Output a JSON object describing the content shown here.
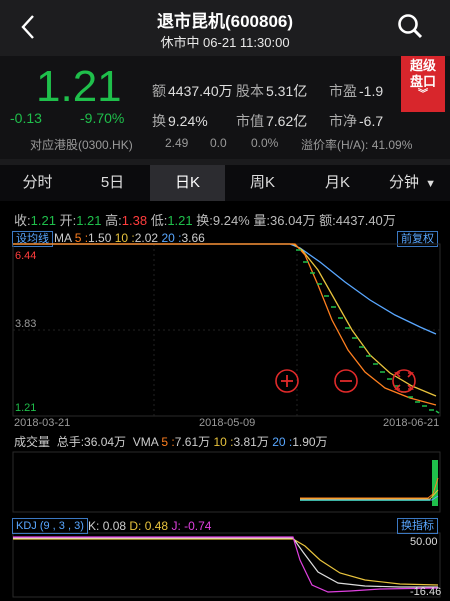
{
  "header": {
    "title": "退市昆机(600806)",
    "subtitle": "休市中 06-21 11:30:00"
  },
  "quote": {
    "price": "1.21",
    "change": "-0.13",
    "change_pct": "-9.70%",
    "amount_label": "额",
    "amount": "4437.40万",
    "share_cap_label": "股本",
    "share_cap": "5.31亿",
    "pe_label": "市盈",
    "pe": "-1.9",
    "turnover_label": "换",
    "turnover": "9.24%",
    "mkt_cap_label": "市值",
    "mkt_cap": "7.62亿",
    "pb_label": "市净",
    "pb": "-6.7",
    "hk_name": "对应港股(0300.HK)",
    "hk_price": "2.49",
    "hk_chg": "0.0",
    "hk_pct": "0.0%",
    "premium_label": "溢价率(H/A):",
    "premium": "41.09%",
    "super_l1": "超级",
    "super_l2": "盘口"
  },
  "tabs": [
    "分时",
    "5日",
    "日K",
    "周K",
    "月K",
    "分钟"
  ],
  "ohlc": {
    "close_label": "收:",
    "close": "1.21",
    "open_label": "开:",
    "open": "1.21",
    "high_label": "高:",
    "high": "1.38",
    "low_label": "低:",
    "low": "1.21",
    "turn_label": "换:",
    "turn": "9.24%",
    "vol_label": "量:",
    "vol": "36.04万",
    "amt_label": "额:",
    "amt": "4437.40万"
  },
  "kline": {
    "settings_btn": "设均线",
    "adjust_btn": "前复权",
    "ma_label": "MA",
    "ma5_label": "5 :",
    "ma5": "1.50",
    "ma10_label": "10 :",
    "ma10": "2.02",
    "ma20_label": "20 :",
    "ma20": "3.66",
    "y_top": "6.44",
    "y_mid": "3.83",
    "y_low": "1.21",
    "dates": [
      "2018-03-21",
      "2018-05-09",
      "2018-06-21"
    ],
    "zoom_in": "+",
    "zoom_out": "−"
  },
  "volume": {
    "title": "成交量",
    "total_label": "总手:",
    "total": "36.04万",
    "vma_label": "VMA",
    "v5_label": "5 :",
    "v5": "7.61万",
    "v10_label": "10 :",
    "v10": "3.81万",
    "v20_label": "20 :",
    "v20": "1.90万"
  },
  "kdj": {
    "name": "KDJ (9 , 3 , 3)",
    "k_label": "K:",
    "k": "0.08",
    "d_label": "D:",
    "d": "0.48",
    "j_label": "J:",
    "j": "-0.74",
    "switch_btn": "换指标",
    "y_top": "50.00",
    "y_bottom": "-16.46"
  },
  "colors": {
    "green": "#1fbf4b",
    "red": "#ff3d3d",
    "ma5": "#ff7f1f",
    "ma10": "#e8c33d",
    "ma20": "#59a7ff",
    "j": "#e040e0"
  }
}
